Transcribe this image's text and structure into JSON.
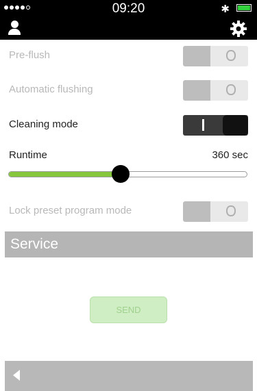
{
  "status_bar": {
    "time": "09:20",
    "battery_color": "#35d23f"
  },
  "header": {
    "left_icon": "user-icon",
    "right_icon": "gear-icon",
    "background": "#000000"
  },
  "settings": [
    {
      "label": "Pre-flush",
      "enabled": false,
      "state": "off",
      "off_glyph": "O"
    },
    {
      "label": "Automatic flushing",
      "enabled": false,
      "state": "off",
      "off_glyph": "O"
    },
    {
      "label": "Cleaning mode",
      "enabled": true,
      "state": "on",
      "on_glyph": "I"
    }
  ],
  "runtime": {
    "label": "Runtime",
    "value_text": "360 sec",
    "fraction": 0.47,
    "fill_color": "#86c63d"
  },
  "lock_setting": {
    "label": "Lock preset program mode",
    "enabled": false,
    "state": "off",
    "off_glyph": "O"
  },
  "service": {
    "title": "Service",
    "send_label": "SEND"
  },
  "footer": {
    "back_icon": "back-arrow-icon"
  }
}
